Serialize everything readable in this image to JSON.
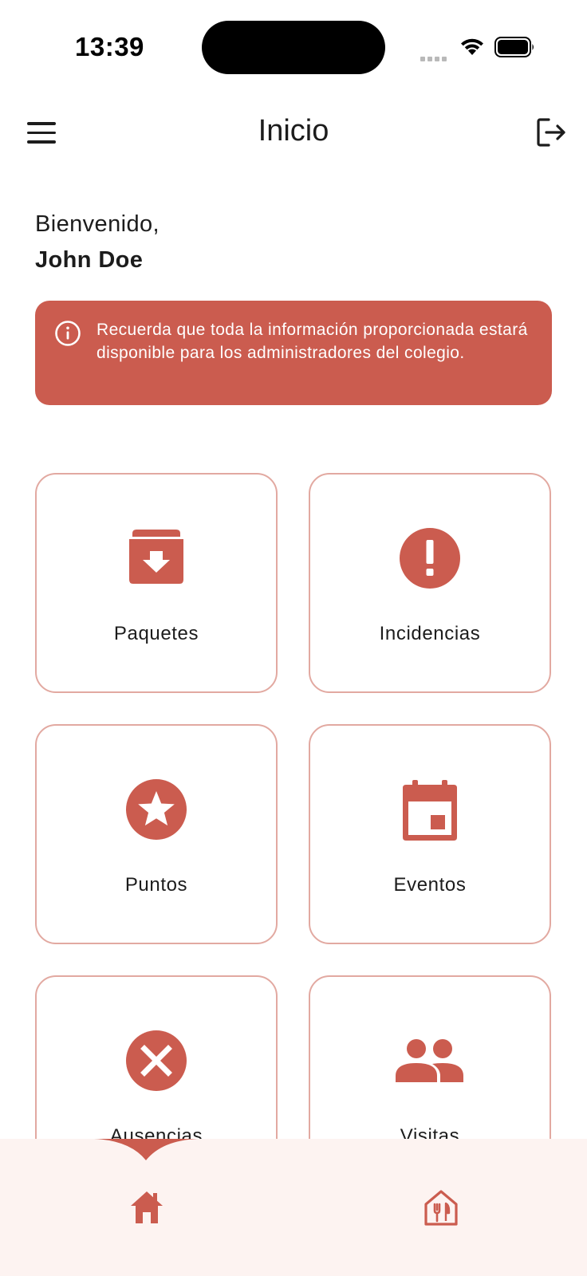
{
  "status_bar": {
    "time": "13:39"
  },
  "header": {
    "title": "Inicio"
  },
  "welcome": {
    "greeting": "Bienvenido,",
    "user_name": "John Doe"
  },
  "banner": {
    "message": "Recuerda que toda la información proporcionada estará disponible para los administradores del colegio."
  },
  "menu_cards": [
    {
      "label": "Paquetes",
      "icon": "archive-box-icon"
    },
    {
      "label": "Incidencias",
      "icon": "alert-circle-icon"
    },
    {
      "label": "Puntos",
      "icon": "star-circle-icon"
    },
    {
      "label": "Eventos",
      "icon": "calendar-icon"
    },
    {
      "label": "Ausencias",
      "icon": "cancel-circle-icon"
    },
    {
      "label": "Visitas",
      "icon": "people-icon"
    }
  ],
  "bottom_nav": {
    "items": [
      "home-icon",
      "dining-icon"
    ],
    "active": "home-icon"
  },
  "colors": {
    "accent": "#cb5c4f",
    "card_border": "#e2a9a1",
    "nav_background": "#fdf3f1",
    "text": "#1c1c1c"
  }
}
